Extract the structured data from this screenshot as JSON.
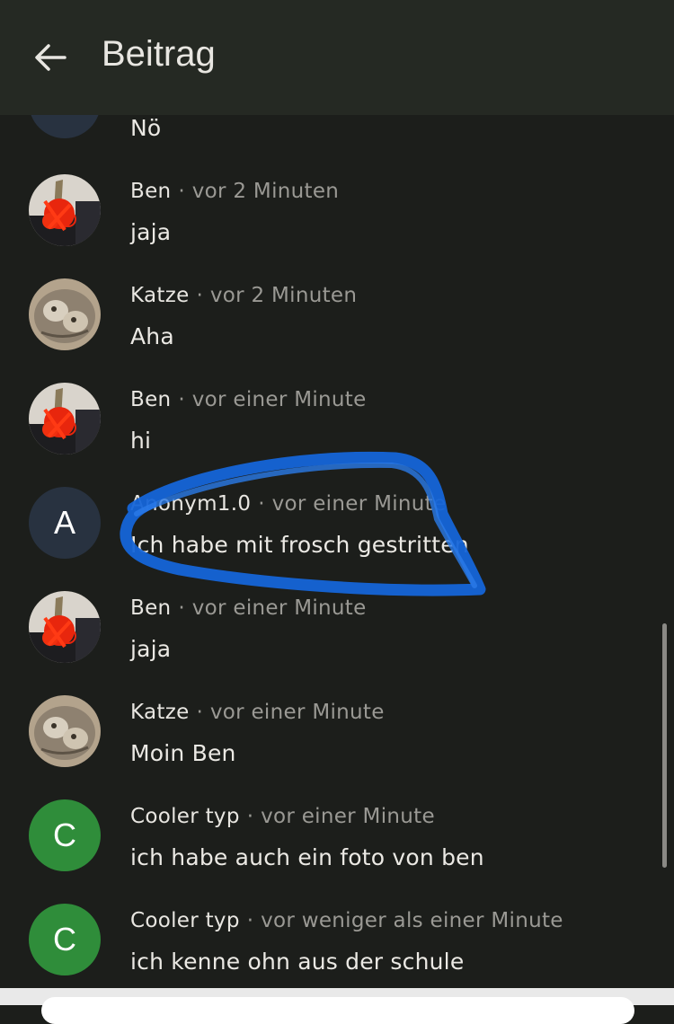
{
  "header": {
    "title": "Beitrag",
    "back_icon": "arrow-left-icon"
  },
  "colors": {
    "background": "#1c1e1b",
    "header": "#252923",
    "anon_avatar": "#283240",
    "green_avatar": "#2f8d3a",
    "scribble": "#1565d8"
  },
  "comments": [
    {
      "author": "",
      "time": "",
      "text": "Nö",
      "avatar": "letter-avatar"
    },
    {
      "author": "Ben",
      "time": "vor 2 Minuten",
      "text": "jaja",
      "avatar": "photo-avatar-ben"
    },
    {
      "author": "Katze",
      "time": "vor 2 Minuten",
      "text": "Aha",
      "avatar": "photo-avatar-cat"
    },
    {
      "author": "Ben",
      "time": "vor einer Minute",
      "text": "hi",
      "avatar": "photo-avatar-ben"
    },
    {
      "author": "Anonym1.0",
      "time": "vor einer Minute",
      "text": "Ich habe mit frosch gestritten",
      "avatar": "A"
    },
    {
      "author": "Ben",
      "time": "vor einer Minute",
      "text": "jaja",
      "avatar": "photo-avatar-ben"
    },
    {
      "author": "Katze",
      "time": "vor einer Minute",
      "text": "Moin Ben",
      "avatar": "photo-avatar-cat"
    },
    {
      "author": "Cooler typ",
      "time": "vor einer Minute",
      "text": "ich habe auch ein foto von ben",
      "avatar": "C"
    },
    {
      "author": "Cooler typ",
      "time": "vor weniger als einer Minute",
      "text": "ich kenne ohn aus der schule",
      "avatar": "C"
    }
  ],
  "separator": "·"
}
